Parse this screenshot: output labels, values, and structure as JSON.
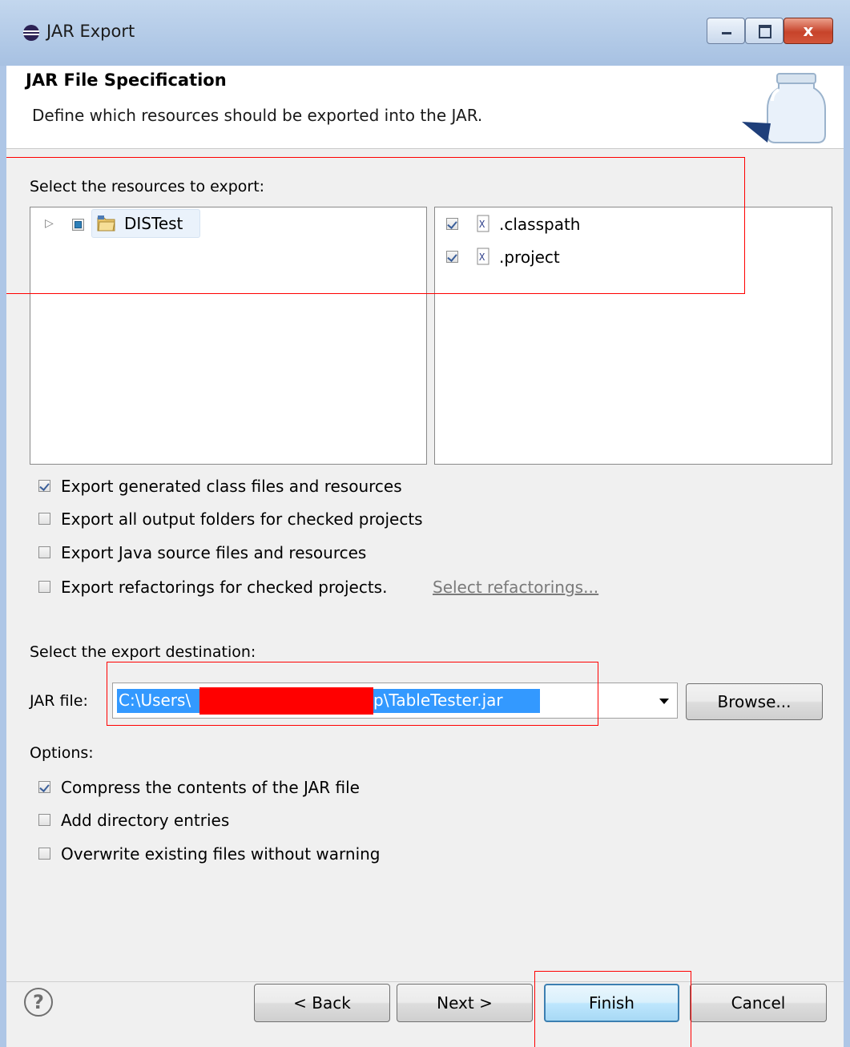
{
  "window": {
    "title": "JAR Export",
    "icon": "eclipse-icon",
    "controls": [
      "minimize-icon",
      "maximize-icon",
      "close-icon"
    ],
    "close_glyph": "x"
  },
  "header": {
    "title": "JAR File Specification",
    "description": "Define which resources should be exported into the JAR.",
    "image": "jar-icon"
  },
  "resources": {
    "label": "Select the resources to export:",
    "tree": [
      {
        "label": "DISTest",
        "expander": "▷",
        "state": "partial",
        "icon": "project-folder-icon"
      }
    ],
    "files": [
      {
        "label": ".classpath",
        "checked": true,
        "icon": "xml-file-icon"
      },
      {
        "label": ".project",
        "checked": true,
        "icon": "xml-file-icon"
      }
    ]
  },
  "export_options": [
    {
      "label": "Export generated class files and resources",
      "checked": true
    },
    {
      "label": "Export all output folders for checked projects",
      "checked": false
    },
    {
      "label": "Export Java source files and resources",
      "checked": false
    },
    {
      "label": "Export refactorings for checked projects.",
      "checked": false,
      "link": "Select refactorings..."
    }
  ],
  "destination": {
    "label": "Select the export destination:",
    "field_label": "JAR file:",
    "path_start": "C:\\Users\\",
    "path_end": "p\\TableTester.jar",
    "browse_label": "Browse..."
  },
  "options": {
    "label": "Options:",
    "items": [
      {
        "label": "Compress the contents of the JAR file",
        "checked": true
      },
      {
        "label": "Add directory entries",
        "checked": false
      },
      {
        "label": "Overwrite existing files without warning",
        "checked": false
      }
    ]
  },
  "buttons": {
    "help": "?",
    "back": "< Back",
    "next": "Next >",
    "finish": "Finish",
    "cancel": "Cancel"
  },
  "colors": {
    "annotation": "#ff0000",
    "selection": "#3399ff",
    "titlebar": "#b5cce9"
  }
}
